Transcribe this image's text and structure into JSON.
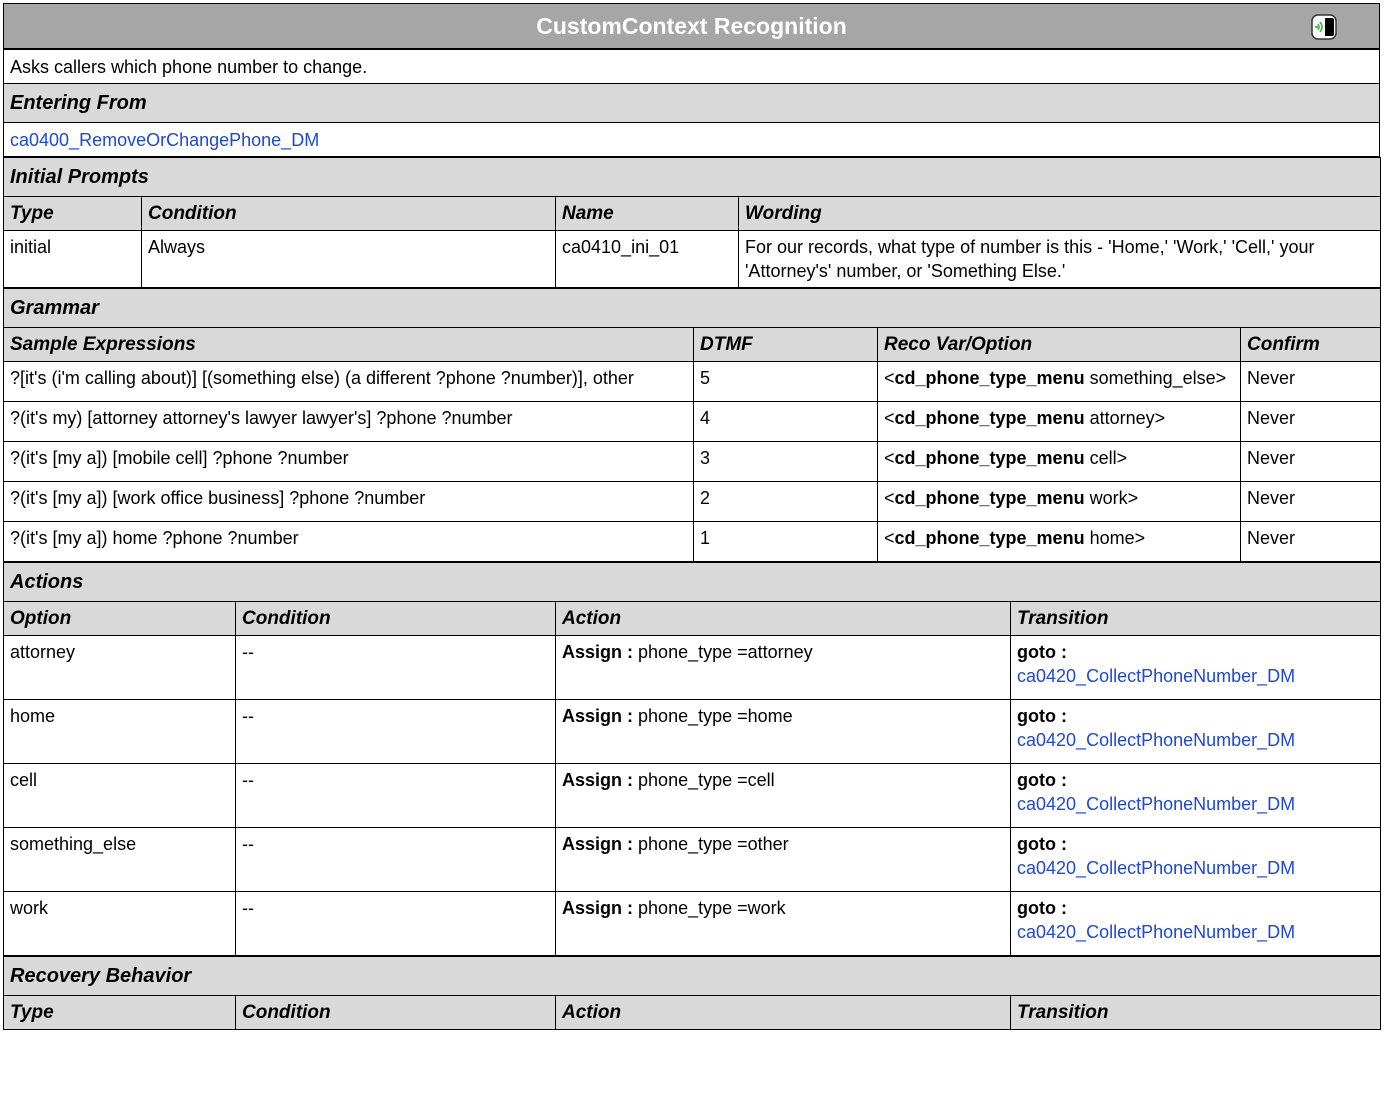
{
  "title": "CustomContext Recognition",
  "icon": "speech-bubble-icon",
  "description": "Asks callers which phone number to change.",
  "entering_from": {
    "heading": "Entering From",
    "link": "ca0400_RemoveOrChangePhone_DM"
  },
  "initial_prompts": {
    "heading": "Initial Prompts",
    "columns": [
      "Type",
      "Condition",
      "Name",
      "Wording"
    ],
    "rows": [
      {
        "type": "initial",
        "condition": "Always",
        "name": "ca0410_ini_01",
        "wording": "For our records, what type of number is this - 'Home,' 'Work,' 'Cell,' your 'Attorney's' number, or 'Something Else.'"
      }
    ]
  },
  "grammar": {
    "heading": "Grammar",
    "columns": [
      "Sample Expressions",
      "DTMF",
      "Reco Var/Option",
      "Confirm"
    ],
    "rows": [
      {
        "expr": "?[it's (i'm calling about)] [(something else) (a different ?phone ?number)], other",
        "dtmf": "5",
        "var": "cd_phone_type_menu",
        "opt": "something_else>",
        "confirm": "Never"
      },
      {
        "expr": "?(it's my) [attorney attorney's lawyer lawyer's]  ?phone ?number",
        "dtmf": "4",
        "var": "cd_phone_type_menu",
        "opt": "attorney>",
        "confirm": "Never"
      },
      {
        "expr": "?(it's [my a]) [mobile cell] ?phone ?number",
        "dtmf": "3",
        "var": "cd_phone_type_menu",
        "opt": "cell>",
        "confirm": "Never"
      },
      {
        "expr": "?(it's [my a]) [work office business]  ?phone ?number",
        "dtmf": "2",
        "var": "cd_phone_type_menu",
        "opt": "work>",
        "confirm": "Never"
      },
      {
        "expr": "?(it's [my a]) home ?phone ?number",
        "dtmf": "1",
        "var": "cd_phone_type_menu",
        "opt": "home>",
        "confirm": "Never"
      }
    ]
  },
  "actions": {
    "heading": "Actions",
    "columns": [
      "Option",
      "Condition",
      "Action",
      "Transition"
    ],
    "assign_label": "Assign :",
    "goto_label": "goto :",
    "rows": [
      {
        "option": "attorney",
        "condition": "--",
        "action": "phone_type =attorney",
        "target": "ca0420_CollectPhoneNumber_DM"
      },
      {
        "option": "home",
        "condition": "--",
        "action": "phone_type =home",
        "target": "ca0420_CollectPhoneNumber_DM"
      },
      {
        "option": "cell",
        "condition": "--",
        "action": "phone_type =cell",
        "target": "ca0420_CollectPhoneNumber_DM"
      },
      {
        "option": "something_else",
        "condition": "--",
        "action": "phone_type =other",
        "target": "ca0420_CollectPhoneNumber_DM"
      },
      {
        "option": "work",
        "condition": "--",
        "action": "phone_type =work",
        "target": "ca0420_CollectPhoneNumber_DM"
      }
    ]
  },
  "recovery": {
    "heading": "Recovery Behavior",
    "columns": [
      "Type",
      "Condition",
      "Action",
      "Transition"
    ]
  }
}
